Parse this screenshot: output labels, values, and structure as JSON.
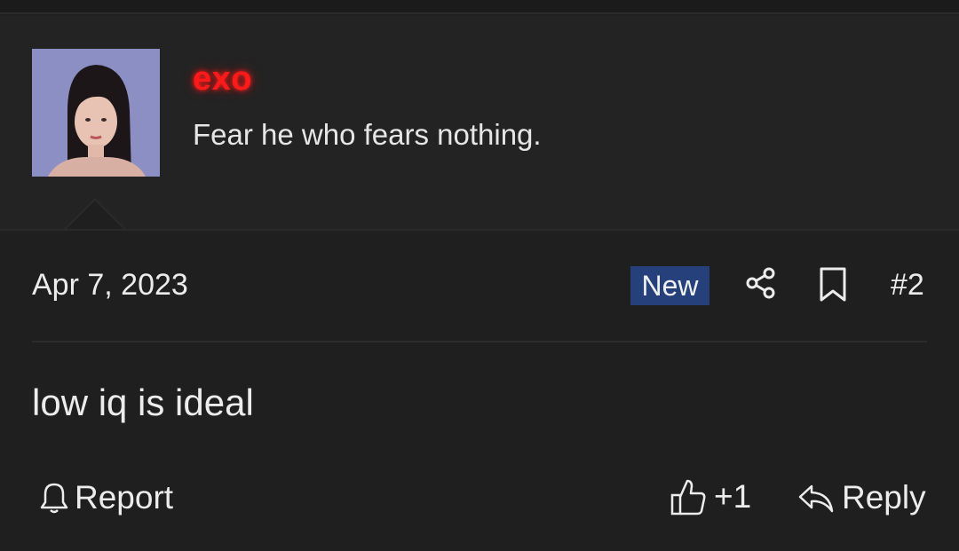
{
  "user": {
    "name": "exo",
    "title": "Fear he who fears nothing."
  },
  "post": {
    "date": "Apr 7, 2023",
    "badge": "New",
    "number": "#2",
    "body": "low iq is ideal",
    "reactions": "+1"
  },
  "actions": {
    "report_label": "Report",
    "reply_label": "Reply"
  },
  "icons": {
    "share": "share-icon",
    "bookmark": "bookmark-icon",
    "report": "bell-icon",
    "like": "thumbs-up-icon",
    "reply": "reply-arrow-icon"
  },
  "colors": {
    "username": "#ff1a1a",
    "badge": "#25407a",
    "background": "#1f1f1f"
  }
}
